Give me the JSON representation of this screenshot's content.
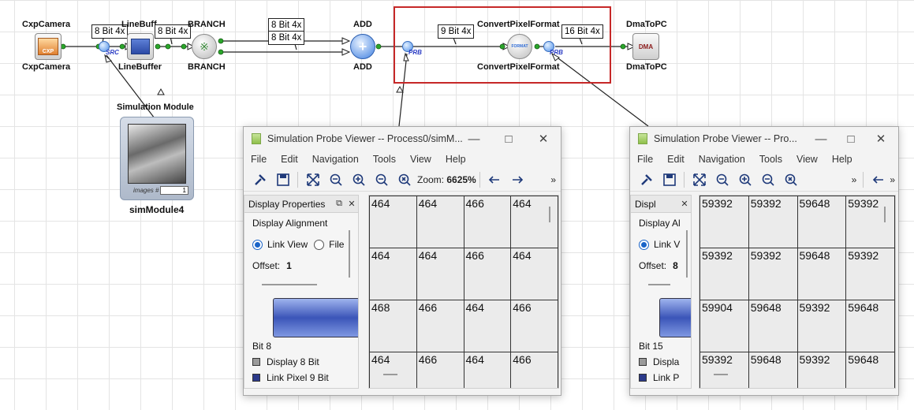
{
  "graph": {
    "nodes": {
      "cxp_camera": {
        "top_label": "CxpCamera",
        "bottom_label": "CxpCamera",
        "icon_text": "CXP"
      },
      "line_buffer": {
        "top_label": "LineBuff",
        "bottom_label": "LineBuffer"
      },
      "branch": {
        "top_label": "BRANCH",
        "bottom_label": "BRANCH"
      },
      "add": {
        "top_label": "ADD",
        "bottom_label": "ADD",
        "icon_text": "+"
      },
      "convert_pixel_format": {
        "top_label": "ConvertPixelFormat",
        "bottom_label": "ConvertPixelFormat",
        "icon_text": "FORMAT"
      },
      "dma_to_pc": {
        "top_label": "DmaToPC",
        "bottom_label": "DmaToPC",
        "icon_text": "DMA"
      },
      "sim_module": {
        "top_label": "Simulation Module",
        "bottom_label": "simModule4",
        "images_label": "images #",
        "images_count": "1"
      }
    },
    "bit_tags": {
      "cam_out": "8 Bit 4x",
      "buffer_out": "8 Bit 4x",
      "branch_out_a": "8 Bit 4x",
      "branch_out_b": "8 Bit 4x",
      "add_out": "9 Bit 4x",
      "convert_out": "16 Bit 4x"
    },
    "probe_labels": {
      "src": "SRC",
      "prb1": "PRB",
      "prb2": "PRB"
    },
    "highlight_color": "#c62828"
  },
  "viewer_left": {
    "title": "Simulation Probe Viewer -- Process0/simM...",
    "menu": [
      "File",
      "Edit",
      "Navigation",
      "Tools",
      "View",
      "Help"
    ],
    "zoom_label": "Zoom:",
    "zoom_value": "6625%",
    "overflow": "»",
    "props": {
      "header": "Display Properties",
      "alignment": "Display Alignment",
      "link_view": "Link View",
      "file_view": "File",
      "offset_label": "Offset:",
      "offset_value": "1",
      "bit_label": "Bit 8",
      "legend_display": "Display 8 Bit",
      "legend_link": "Link Pixel 9 Bit"
    },
    "cells": [
      [
        "464",
        "464",
        "466",
        "464"
      ],
      [
        "464",
        "464",
        "466",
        "464"
      ],
      [
        "468",
        "466",
        "464",
        "466"
      ],
      [
        "464",
        "466",
        "464",
        "466"
      ]
    ]
  },
  "viewer_right": {
    "title": "Simulation Probe Viewer -- Pro...",
    "menu": [
      "File",
      "Edit",
      "Navigation",
      "Tools",
      "View",
      "Help"
    ],
    "overflow": "»",
    "props": {
      "header": "Displ",
      "alignment": "Display Al",
      "link_view": "Link V",
      "offset_label": "Offset:",
      "offset_value": "8",
      "bit_label": "Bit 15",
      "legend_display": "Displa",
      "legend_link": "Link P"
    },
    "cells": [
      [
        "59392",
        "59392",
        "59648",
        "59392"
      ],
      [
        "59392",
        "59392",
        "59648",
        "59392"
      ],
      [
        "59904",
        "59648",
        "59392",
        "59648"
      ],
      [
        "59392",
        "59648",
        "59392",
        "59648"
      ]
    ]
  },
  "colors": {
    "bit_display": "#9a9a9a",
    "bit_link": "#2b3a8a"
  }
}
